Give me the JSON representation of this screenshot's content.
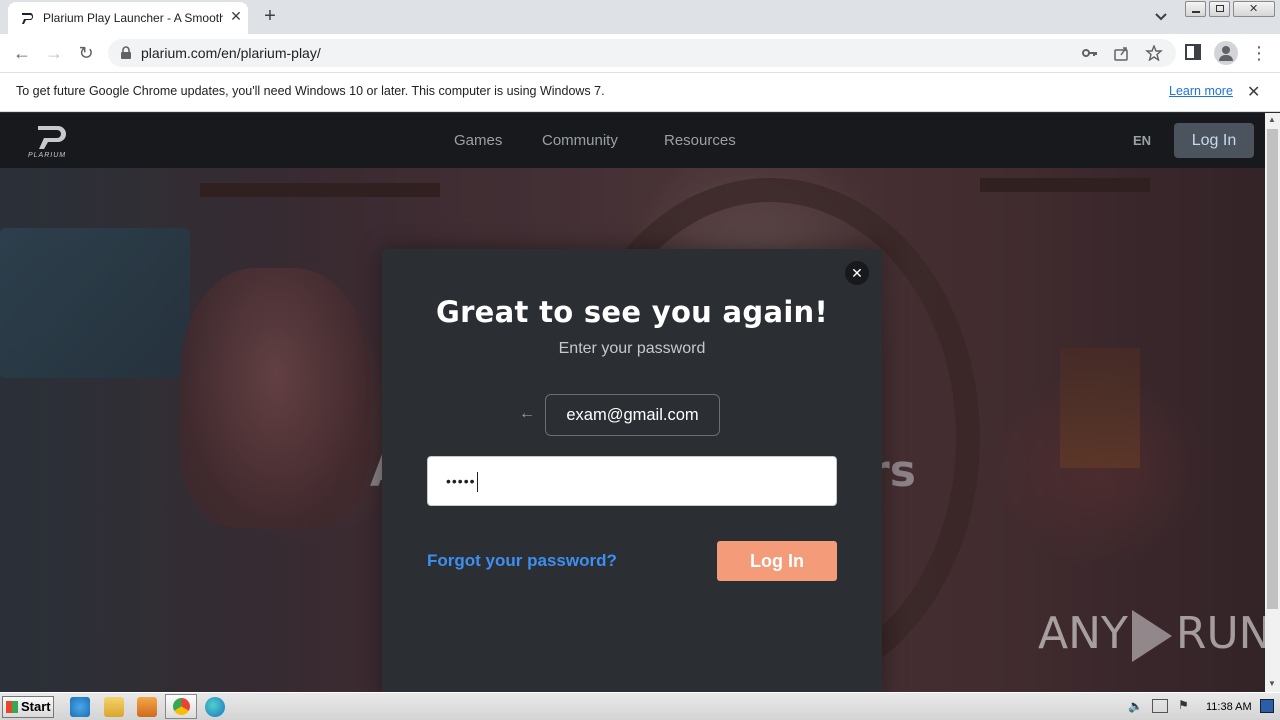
{
  "browser": {
    "tab_title": "Plarium Play Launcher - A Smoother",
    "tab_close": "✕",
    "new_tab": "+",
    "url": "plarium.com/en/plarium-play/"
  },
  "infobar": {
    "message": "To get future Google Chrome updates, you'll need Windows 10 or later. This computer is using Windows 7.",
    "learn_more": "Learn more",
    "close": "✕"
  },
  "site_nav": {
    "logo_text": "PLARIUM",
    "links": [
      "Games",
      "Community",
      "Resources"
    ],
    "language": "EN",
    "login_label": "Log In"
  },
  "hero": {
    "text_left": "A",
    "text_right": "rs"
  },
  "modal": {
    "close": "✕",
    "heading": "Great to see you again!",
    "subheading": "Enter your password",
    "back_arrow": "←",
    "email": "exam@gmail.com",
    "password_masked": "•••••",
    "forgot_link": "Forgot your password?",
    "login_button": "Log In"
  },
  "watermark": {
    "left": "ANY",
    "right": "RUN"
  },
  "taskbar": {
    "start_label": "Start",
    "clock": "11:38 AM"
  },
  "colors": {
    "login_button": "#f49b79",
    "forgot_link": "#3d8ff0",
    "modal_bg": "#2b2e33",
    "site_nav_bg": "#17191c"
  }
}
